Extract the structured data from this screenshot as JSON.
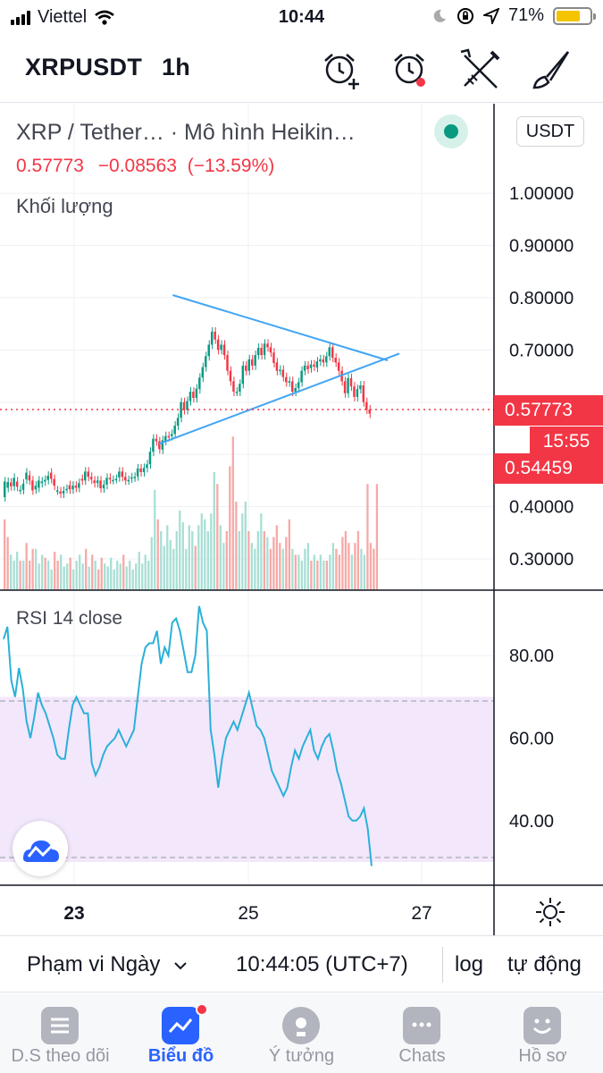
{
  "status_bar": {
    "carrier": "Viettel",
    "time": "10:44",
    "battery": "71%",
    "battery_level": 0.71
  },
  "toolbar": {
    "symbol": "XRPUSDT",
    "interval": "1h",
    "icons": [
      "alarm-add-icon",
      "alarm-icon",
      "tools-icon",
      "brush-icon"
    ]
  },
  "legend": {
    "title": "XRP / Tether…  ·  Mô hình Heikin…",
    "price": "0.57773",
    "change": "−0.08563",
    "change_pct": "(−13.59%)",
    "volume_label": "Khối lượng",
    "currency_button": "USDT"
  },
  "price_axis": {
    "ticks": [
      "1.00000",
      "0.90000",
      "0.80000",
      "0.70000",
      "0.40000",
      "0.30000"
    ],
    "current_price_tag": "0.57773",
    "countdown_tag": "15:55",
    "low_tag": "0.54459",
    "up_color": "#089981",
    "down_color": "#f23645"
  },
  "rsi": {
    "label": "RSI 14 close",
    "ticks": [
      "80.00",
      "60.00",
      "40.00"
    ],
    "band_color": "#f3e7fc",
    "line_color": "#2ab1d8"
  },
  "time_axis": {
    "ticks": [
      "23",
      "25",
      "27"
    ]
  },
  "chart_data": {
    "type": "candlestick",
    "symbol": "XRPUSDT",
    "interval": "1h",
    "price_range": [
      0.24,
      1.12
    ],
    "last_price": 0.57773,
    "candles": [
      [
        0.418,
        0.448
      ],
      [
        0.436,
        0.447
      ],
      [
        0.446,
        0.439
      ],
      [
        0.439,
        0.455
      ],
      [
        0.448,
        0.438
      ],
      [
        0.432,
        0.432
      ],
      [
        0.432,
        0.444
      ],
      [
        0.452,
        0.465
      ],
      [
        0.46,
        0.45
      ],
      [
        0.45,
        0.431
      ],
      [
        0.433,
        0.44
      ],
      [
        0.436,
        0.45
      ],
      [
        0.445,
        0.448
      ],
      [
        0.448,
        0.451
      ],
      [
        0.451,
        0.459
      ],
      [
        0.465,
        0.453
      ],
      [
        0.453,
        0.44
      ],
      [
        0.431,
        0.431
      ],
      [
        0.429,
        0.425
      ],
      [
        0.425,
        0.43
      ],
      [
        0.434,
        0.434
      ],
      [
        0.441,
        0.433
      ],
      [
        0.433,
        0.44
      ],
      [
        0.44,
        0.436
      ],
      [
        0.436,
        0.445
      ],
      [
        0.453,
        0.45
      ],
      [
        0.45,
        0.467
      ],
      [
        0.467,
        0.457
      ],
      [
        0.457,
        0.452
      ],
      [
        0.45,
        0.445
      ],
      [
        0.445,
        0.45
      ],
      [
        0.45,
        0.435
      ],
      [
        0.435,
        0.442
      ],
      [
        0.442,
        0.455
      ],
      [
        0.455,
        0.452
      ],
      [
        0.451,
        0.451
      ],
      [
        0.453,
        0.453
      ],
      [
        0.456,
        0.467
      ],
      [
        0.467,
        0.457
      ],
      [
        0.457,
        0.45
      ],
      [
        0.45,
        0.451
      ],
      [
        0.454,
        0.456
      ],
      [
        0.456,
        0.457
      ],
      [
        0.458,
        0.473
      ],
      [
        0.473,
        0.466
      ],
      [
        0.466,
        0.474
      ],
      [
        0.474,
        0.481
      ],
      [
        0.481,
        0.505
      ],
      [
        0.505,
        0.53
      ],
      [
        0.53,
        0.525
      ],
      [
        0.525,
        0.51
      ],
      [
        0.509,
        0.527
      ],
      [
        0.526,
        0.535
      ],
      [
        0.535,
        0.533
      ],
      [
        0.535,
        0.539
      ],
      [
        0.539,
        0.555
      ],
      [
        0.555,
        0.57
      ],
      [
        0.57,
        0.6
      ],
      [
        0.6,
        0.585
      ],
      [
        0.585,
        0.602
      ],
      [
        0.602,
        0.62
      ],
      [
        0.62,
        0.608
      ],
      [
        0.608,
        0.626
      ],
      [
        0.625,
        0.647
      ],
      [
        0.647,
        0.667
      ],
      [
        0.667,
        0.688
      ],
      [
        0.688,
        0.71
      ],
      [
        0.71,
        0.735
      ],
      [
        0.735,
        0.72
      ],
      [
        0.72,
        0.7
      ],
      [
        0.7,
        0.71
      ],
      [
        0.71,
        0.69
      ],
      [
        0.69,
        0.66
      ],
      [
        0.66,
        0.64
      ],
      [
        0.64,
        0.62
      ],
      [
        0.62,
        0.62
      ],
      [
        0.62,
        0.635
      ],
      [
        0.635,
        0.67
      ],
      [
        0.67,
        0.66
      ],
      [
        0.66,
        0.682
      ],
      [
        0.682,
        0.67
      ],
      [
        0.67,
        0.69
      ],
      [
        0.69,
        0.704
      ],
      [
        0.704,
        0.69
      ],
      [
        0.69,
        0.712
      ],
      [
        0.712,
        0.705
      ],
      [
        0.705,
        0.695
      ],
      [
        0.695,
        0.675
      ],
      [
        0.676,
        0.66
      ],
      [
        0.66,
        0.662
      ],
      [
        0.662,
        0.648
      ],
      [
        0.648,
        0.638
      ],
      [
        0.638,
        0.64
      ],
      [
        0.64,
        0.62
      ],
      [
        0.62,
        0.627
      ],
      [
        0.627,
        0.638
      ],
      [
        0.638,
        0.66
      ],
      [
        0.66,
        0.67
      ],
      [
        0.67,
        0.663
      ],
      [
        0.665,
        0.672
      ],
      [
        0.672,
        0.668
      ],
      [
        0.666,
        0.678
      ],
      [
        0.678,
        0.682
      ],
      [
        0.682,
        0.676
      ],
      [
        0.676,
        0.688
      ],
      [
        0.688,
        0.705
      ],
      [
        0.705,
        0.685
      ],
      [
        0.685,
        0.676
      ],
      [
        0.676,
        0.66
      ],
      [
        0.66,
        0.64
      ],
      [
        0.64,
        0.617
      ],
      [
        0.617,
        0.646
      ],
      [
        0.646,
        0.63
      ],
      [
        0.63,
        0.61
      ],
      [
        0.61,
        0.625
      ],
      [
        0.625,
        0.632
      ],
      [
        0.632,
        0.6
      ],
      [
        0.6,
        0.586
      ],
      [
        0.586,
        0.578
      ]
    ],
    "volume": [
      [
        0.24,
        0.5
      ],
      [
        0.18,
        0.5
      ],
      [
        0.12,
        0.2
      ],
      [
        0.1,
        0.2
      ],
      [
        0.13,
        0.2
      ],
      [
        0.1,
        0.5
      ],
      [
        0.1,
        0.2
      ],
      [
        0.16,
        0.5
      ],
      [
        0.1,
        0.5
      ],
      [
        0.14,
        0.5
      ],
      [
        0.14,
        0.2
      ],
      [
        0.09,
        0.2
      ],
      [
        0.12,
        0.2
      ],
      [
        0.11,
        0.5
      ],
      [
        0.1,
        0.2
      ],
      [
        0.07,
        0.2
      ],
      [
        0.13,
        0.5
      ],
      [
        0.1,
        0.5
      ],
      [
        0.12,
        0.2
      ],
      [
        0.08,
        0.2
      ],
      [
        0.09,
        0.2
      ],
      [
        0.11,
        0.5
      ],
      [
        0.07,
        0.2
      ],
      [
        0.1,
        0.2
      ],
      [
        0.12,
        0.2
      ],
      [
        0.09,
        0.2
      ],
      [
        0.14,
        0.5
      ],
      [
        0.08,
        0.2
      ],
      [
        0.12,
        0.5
      ],
      [
        0.1,
        0.2
      ],
      [
        0.07,
        0.5
      ],
      [
        0.11,
        0.5
      ],
      [
        0.09,
        0.2
      ],
      [
        0.08,
        0.2
      ],
      [
        0.11,
        0.2
      ],
      [
        0.07,
        0.2
      ],
      [
        0.1,
        0.2
      ],
      [
        0.09,
        0.2
      ],
      [
        0.12,
        0.5
      ],
      [
        0.08,
        0.2
      ],
      [
        0.1,
        0.2
      ],
      [
        0.07,
        0.2
      ],
      [
        0.09,
        0.2
      ],
      [
        0.13,
        0.2
      ],
      [
        0.09,
        0.2
      ],
      [
        0.12,
        0.2
      ],
      [
        0.1,
        0.2
      ],
      [
        0.18,
        0.2
      ],
      [
        0.34,
        0.2
      ],
      [
        0.24,
        0.5
      ],
      [
        0.2,
        0.2
      ],
      [
        0.15,
        0.2
      ],
      [
        0.22,
        0.2
      ],
      [
        0.17,
        0.2
      ],
      [
        0.14,
        0.2
      ],
      [
        0.2,
        0.2
      ],
      [
        0.27,
        0.2
      ],
      [
        0.23,
        0.2
      ],
      [
        0.14,
        0.2
      ],
      [
        0.22,
        0.2
      ],
      [
        0.2,
        0.2
      ],
      [
        0.15,
        0.5
      ],
      [
        0.22,
        0.2
      ],
      [
        0.26,
        0.2
      ],
      [
        0.24,
        0.2
      ],
      [
        0.2,
        0.2
      ],
      [
        0.26,
        0.2
      ],
      [
        0.4,
        0.2
      ],
      [
        0.36,
        0.5
      ],
      [
        0.22,
        0.2
      ],
      [
        0.16,
        0.2
      ],
      [
        0.2,
        0.5
      ],
      [
        0.42,
        0.5
      ],
      [
        0.52,
        0.5
      ],
      [
        0.3,
        0.5
      ],
      [
        0.2,
        0.2
      ],
      [
        0.26,
        0.2
      ],
      [
        0.3,
        0.2
      ],
      [
        0.2,
        0.5
      ],
      [
        0.16,
        0.2
      ],
      [
        0.14,
        0.2
      ],
      [
        0.2,
        0.2
      ],
      [
        0.26,
        0.2
      ],
      [
        0.2,
        0.5
      ],
      [
        0.18,
        0.2
      ],
      [
        0.14,
        0.5
      ],
      [
        0.18,
        0.5
      ],
      [
        0.22,
        0.5
      ],
      [
        0.16,
        0.5
      ],
      [
        0.14,
        0.2
      ],
      [
        0.18,
        0.5
      ],
      [
        0.24,
        0.5
      ],
      [
        0.14,
        0.2
      ],
      [
        0.12,
        0.5
      ],
      [
        0.12,
        0.2
      ],
      [
        0.1,
        0.2
      ],
      [
        0.14,
        0.2
      ],
      [
        0.16,
        0.2
      ],
      [
        0.1,
        0.5
      ],
      [
        0.12,
        0.2
      ],
      [
        0.1,
        0.5
      ],
      [
        0.12,
        0.2
      ],
      [
        0.1,
        0.2
      ],
      [
        0.1,
        0.5
      ],
      [
        0.12,
        0.2
      ],
      [
        0.16,
        0.2
      ],
      [
        0.14,
        0.5
      ],
      [
        0.12,
        0.5
      ],
      [
        0.18,
        0.5
      ],
      [
        0.2,
        0.5
      ],
      [
        0.16,
        0.5
      ],
      [
        0.12,
        0.2
      ],
      [
        0.16,
        0.5
      ],
      [
        0.2,
        0.5
      ],
      [
        0.14,
        0.2
      ],
      [
        0.12,
        0.2
      ],
      [
        0.36,
        0.5
      ],
      [
        0.16,
        0.5
      ],
      [
        0.14,
        0.5
      ],
      [
        0.36,
        0.5
      ]
    ],
    "triangle": {
      "upper": [
        [
          0.4455,
          0.805
        ],
        [
          1.0,
          0.68
        ]
      ],
      "lower": [
        [
          0.41,
          0.52
        ],
        [
          1.0,
          0.68
        ]
      ],
      "apex_extension": [
        0.4455,
        1.03
      ]
    },
    "rsi_values": [
      84,
      87,
      74,
      70,
      77,
      72,
      64,
      60,
      65,
      71,
      68,
      66,
      63,
      60,
      56,
      55,
      55,
      62,
      68,
      70,
      68,
      66,
      66,
      54,
      51,
      53,
      56,
      58,
      59,
      60,
      62,
      60,
      58,
      60,
      62,
      70,
      78,
      82,
      83,
      83,
      86,
      78,
      82,
      80,
      88,
      89,
      86,
      81,
      76,
      76,
      80,
      92,
      88,
      86,
      62,
      56,
      48,
      55,
      60,
      62,
      64,
      62,
      65,
      68,
      71,
      67,
      63,
      62,
      60,
      56,
      52,
      50,
      48,
      46,
      48,
      53,
      57,
      55,
      58,
      60,
      62,
      57,
      55,
      58,
      60,
      61,
      57,
      52,
      49,
      45,
      41,
      40,
      40,
      41,
      43,
      38,
      29
    ],
    "rsi_range": [
      25,
      95
    ],
    "rsi_band": [
      30,
      70
    ]
  },
  "controls": {
    "range": "Phạm vi Ngày",
    "time": "10:44:05 (UTC+7)",
    "log": "log",
    "auto": "tự động"
  },
  "tabs": [
    {
      "label": "D.S theo dõi",
      "icon": "watchlist-icon"
    },
    {
      "label": "Biểu đồ",
      "icon": "chart-icon"
    },
    {
      "label": "Ý tưởng",
      "icon": "ideas-icon"
    },
    {
      "label": "Chats",
      "icon": "chats-icon"
    },
    {
      "label": "Hồ sơ",
      "icon": "profile-icon"
    }
  ]
}
